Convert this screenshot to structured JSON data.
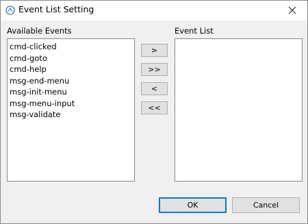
{
  "window": {
    "title": "Event List Setting"
  },
  "available": {
    "label": "Available Events",
    "items": [
      "cmd-clicked",
      "cmd-goto",
      "cmd-help",
      "msg-end-menu",
      "msg-init-menu",
      "msg-menu-input",
      "msg-validate"
    ]
  },
  "event_list": {
    "label": "Event List",
    "items": []
  },
  "buttons": {
    "add": ">",
    "add_all": ">>",
    "remove": "<",
    "remove_all": "<<",
    "ok": "OK",
    "cancel": "Cancel"
  },
  "colors": {
    "accent": "#0078d7",
    "icon": "#5f8ec9"
  }
}
